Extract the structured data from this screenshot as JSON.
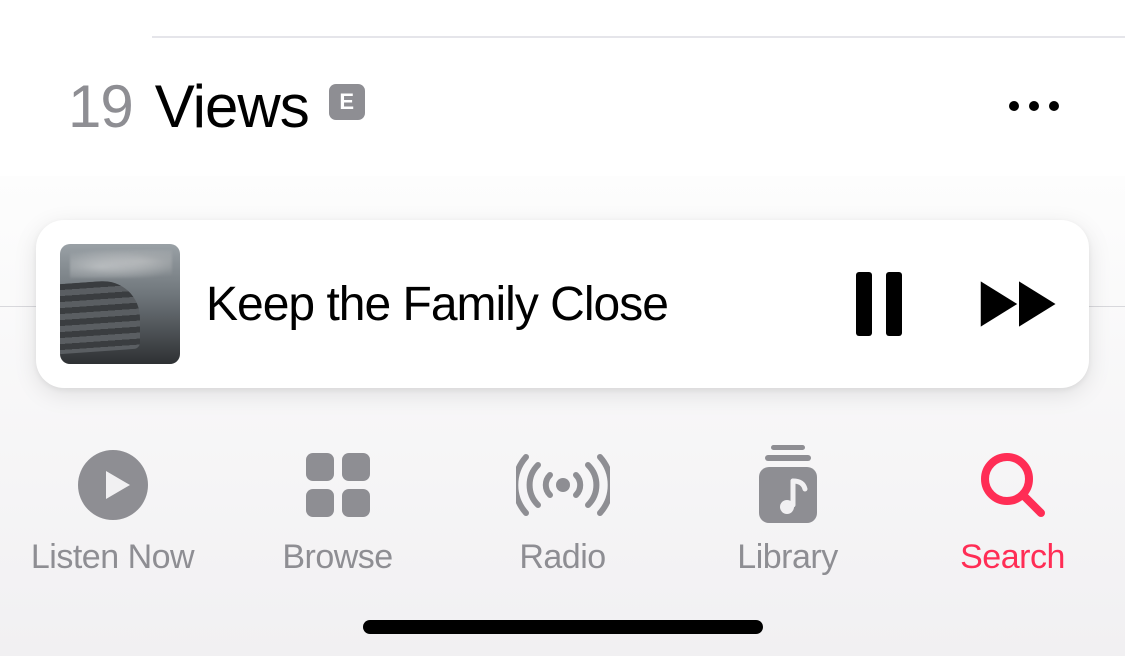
{
  "track": {
    "number": "19",
    "title": "Views",
    "explicit_label": "E"
  },
  "now_playing": {
    "title": "Keep the Family Close"
  },
  "tabs": {
    "listen_now": "Listen Now",
    "browse": "Browse",
    "radio": "Radio",
    "library": "Library",
    "search": "Search"
  },
  "colors": {
    "accent": "#ff2d55",
    "inactive": "#8e8e93"
  },
  "active_tab": "search"
}
